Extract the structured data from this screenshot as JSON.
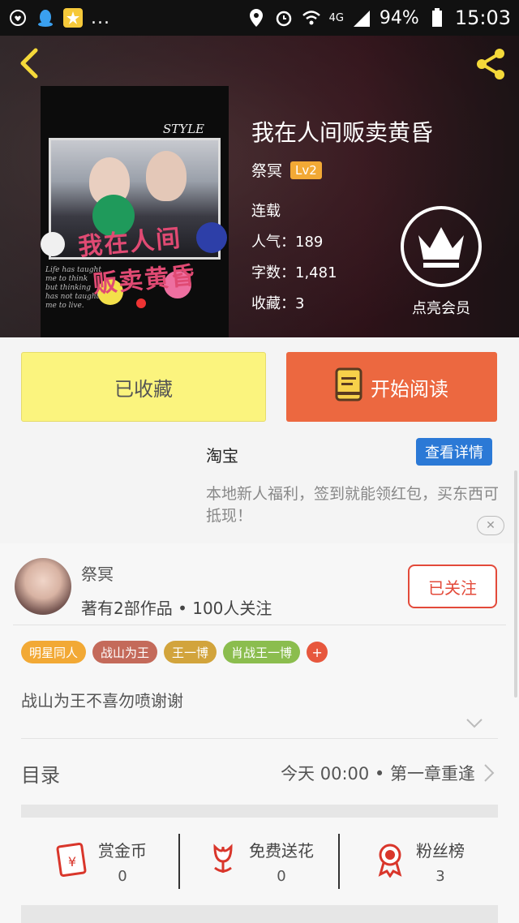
{
  "status_bar": {
    "dots": "...",
    "network": "4G",
    "battery": "94%",
    "time": "15:03"
  },
  "book": {
    "title": "我在人间贩卖黄昏",
    "author": "祭冥",
    "level": "Lv2",
    "status": "连载",
    "popularity": "人气：189",
    "word_count": "字数：1,481",
    "favorites": "收藏：3",
    "cover": {
      "style_word": "STYLE",
      "title_line1": "我在人间",
      "title_line2": "贩卖黄昏",
      "small_text": "Life has taught\nme to think\nbut thinking\nhas not taught\nme to live."
    }
  },
  "vip": {
    "label": "点亮会员",
    "icon": "crown-icon"
  },
  "actions": {
    "collected_label": "已收藏",
    "read_label": "开始阅读"
  },
  "ad": {
    "title": "淘宝",
    "button": "查看详情",
    "text": "本地新人福利，签到就能领红包，买东西可抵现！"
  },
  "author_section": {
    "name": "祭冥",
    "stats": "著有2部作品 • 100人关注",
    "follow_label": "已关注"
  },
  "tags": [
    {
      "label": "明星同人",
      "color": "#f2a935"
    },
    {
      "label": "战山为王",
      "color": "#c46a5a"
    },
    {
      "label": "王一博",
      "color": "#d2a43c"
    },
    {
      "label": "肖战王一博",
      "color": "#8bbd4e"
    }
  ],
  "tag_plus": "+",
  "description": "战山为王不喜勿喷谢谢",
  "toc": {
    "label": "目录",
    "latest": "今天 00:00  •  第一章重逢"
  },
  "rewards": [
    {
      "label": "赏金币",
      "value": "0",
      "icon": "red-envelope-icon"
    },
    {
      "label": "免费送花",
      "value": "0",
      "icon": "flower-icon"
    },
    {
      "label": "粉丝榜",
      "value": "3",
      "icon": "medal-icon"
    }
  ],
  "colors": {
    "accent_orange": "#ec6840",
    "collected_yellow": "#fbf47e",
    "link_blue": "#2b79d6",
    "follow_red": "#e34a3a"
  }
}
